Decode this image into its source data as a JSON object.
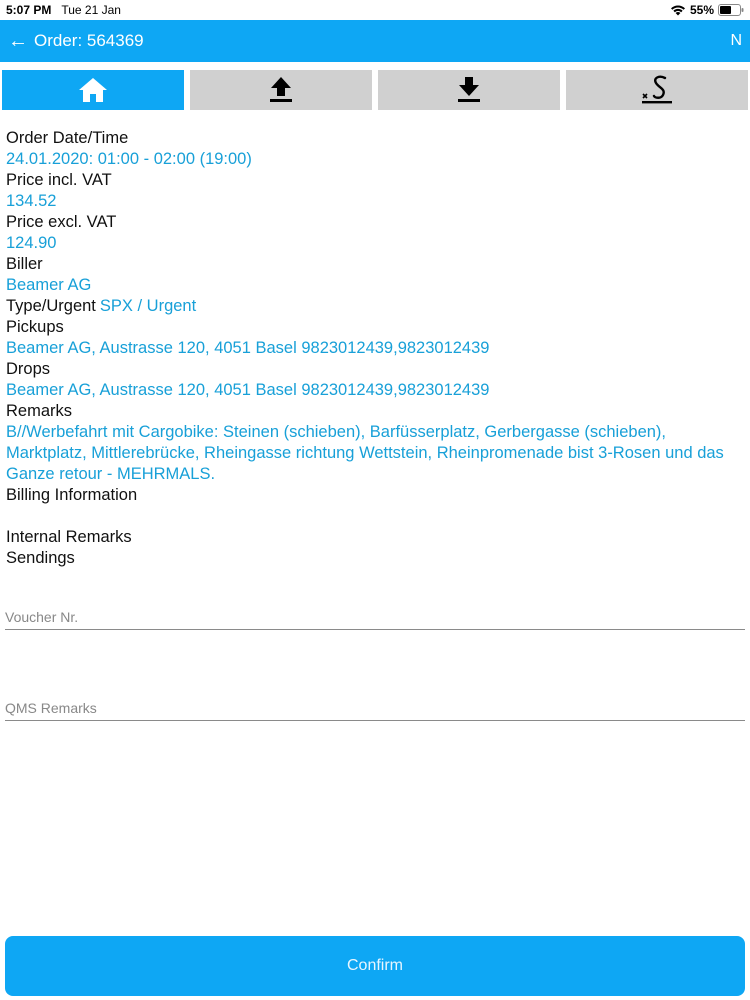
{
  "status_bar": {
    "time": "5:07 PM",
    "date": "Tue 21 Jan",
    "battery": "55%"
  },
  "header": {
    "title": "Order: 564369",
    "right_label": "N"
  },
  "tabs": [
    {
      "name": "home-icon",
      "active": true
    },
    {
      "name": "upload-icon",
      "active": false
    },
    {
      "name": "download-icon",
      "active": false
    },
    {
      "name": "signature-icon",
      "active": false
    }
  ],
  "details": {
    "order_datetime_label": "Order Date/Time",
    "order_datetime_value": "24.01.2020: 01:00 - 02:00 (19:00)",
    "price_incl_label": "Price incl. VAT",
    "price_incl_value": "134.52",
    "price_excl_label": "Price excl. VAT",
    "price_excl_value": "124.90",
    "biller_label": "Biller",
    "biller_value": "Beamer AG",
    "type_label": "Type/Urgent",
    "type_value": "SPX / Urgent",
    "pickups_label": "Pickups",
    "pickups_value": "Beamer AG, Austrasse 120, 4051 Basel 9823012439,9823012439",
    "drops_label": "Drops",
    "drops_value": "Beamer AG, Austrasse 120, 4051 Basel 9823012439,9823012439",
    "remarks_label": "Remarks",
    "remarks_value": "B//Werbefahrt mit Cargobike: Steinen (schieben), Barfüsserplatz, Gerbergasse (schieben), Marktplatz, Mittlerebrücke, Rheingasse richtung Wettstein, Rheinpromenade bist 3-Rosen und das Ganze retour - MEHRMALS.",
    "billing_label": "Billing Information",
    "internal_remarks_label": "Internal Remarks",
    "sendings_label": "Sendings"
  },
  "form": {
    "voucher_placeholder": "Voucher Nr.",
    "qms_placeholder": "QMS Remarks"
  },
  "actions": {
    "confirm_label": "Confirm"
  },
  "colors": {
    "accent": "#0ea7f4",
    "value_text": "#18a0d8",
    "tab_inactive": "#d0d0d0"
  }
}
